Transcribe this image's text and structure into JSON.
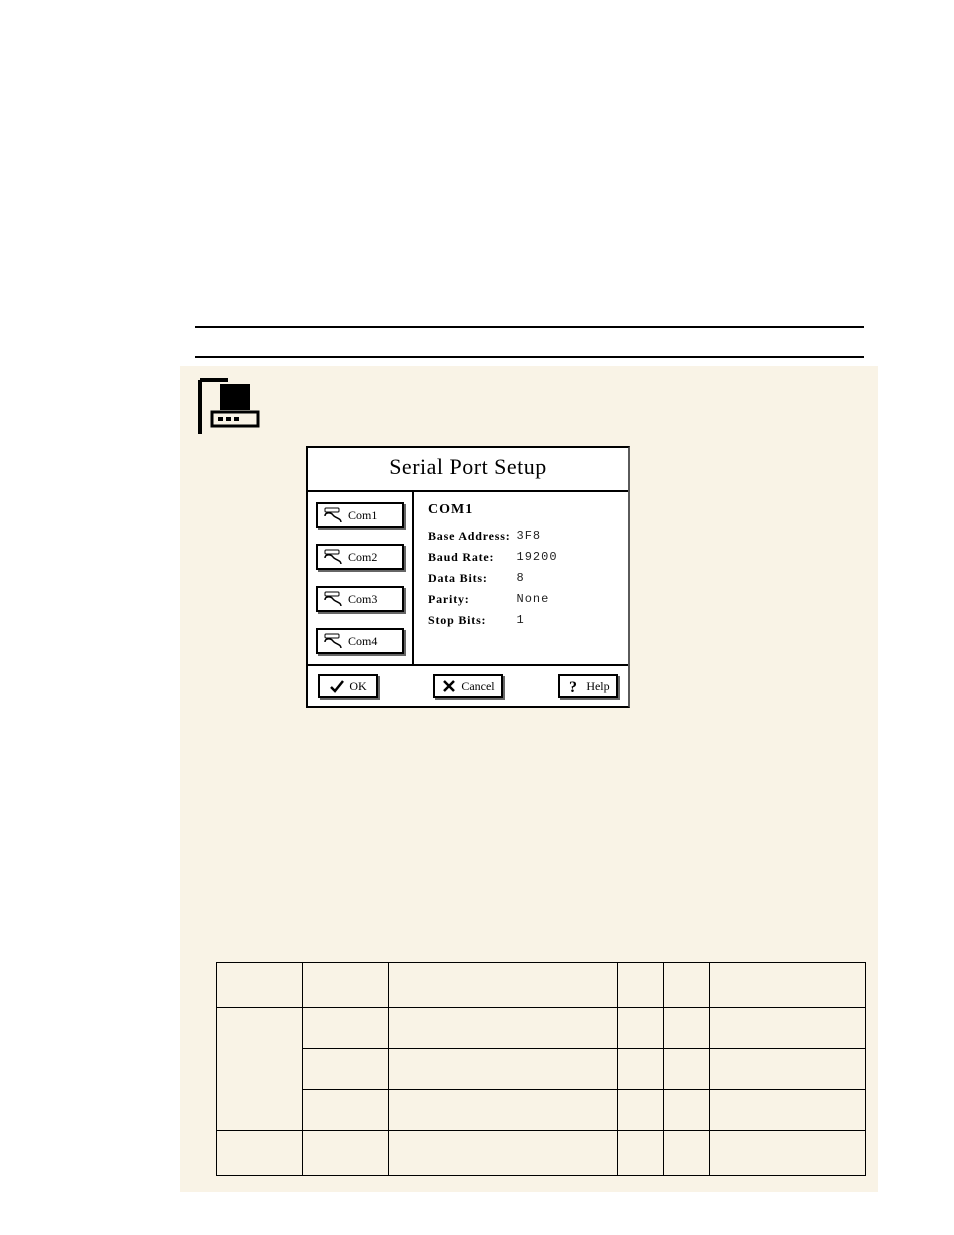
{
  "dialog": {
    "title": "Serial Port Setup",
    "ports": [
      {
        "label": "Com1"
      },
      {
        "label": "Com2"
      },
      {
        "label": "Com3"
      },
      {
        "label": "Com4"
      }
    ],
    "current_port": "COM1",
    "fields": {
      "base_address_label": "Base Address:",
      "base_address_value": "3F8",
      "baud_rate_label": "Baud Rate:",
      "baud_rate_value": "19200",
      "data_bits_label": "Data Bits:",
      "data_bits_value": "8",
      "parity_label": "Parity:",
      "parity_value": "None",
      "stop_bits_label": "Stop Bits:",
      "stop_bits_value": "1"
    },
    "buttons": {
      "ok": "OK",
      "cancel": "Cancel",
      "help": "Help"
    }
  },
  "colors": {
    "cream": "#f9f3e6"
  }
}
